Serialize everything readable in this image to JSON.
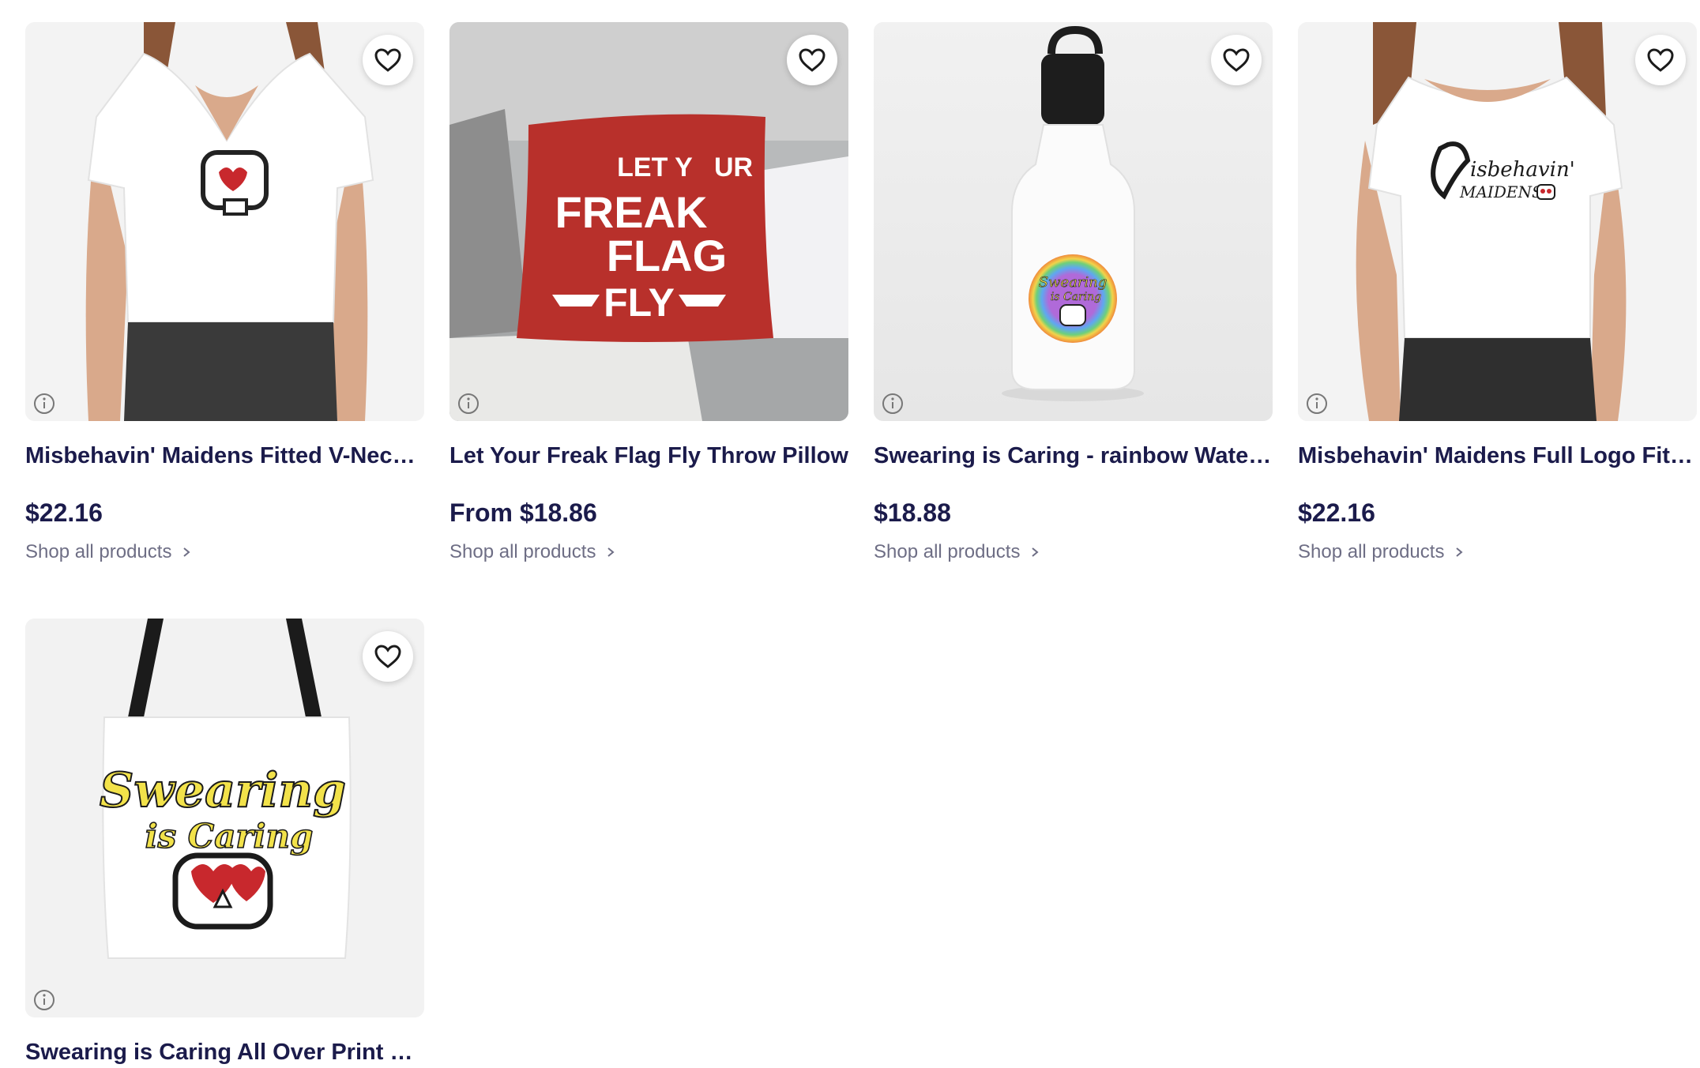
{
  "products": [
    {
      "title": "Misbehavin' Maidens Fitted V-Neck T-Shirt",
      "price": "$22.16",
      "shop_label": "Shop all products",
      "art_text": ""
    },
    {
      "title": "Let Your Freak Flag Fly Throw Pillow",
      "price": "From $18.86",
      "shop_label": "Shop all products",
      "art_lines": [
        "LET Y",
        "UR",
        "FREAK",
        "FLAG",
        "FLY"
      ]
    },
    {
      "title": "Swearing is Caring - rainbow Water Bottle",
      "price": "$18.88",
      "shop_label": "Shop all products",
      "art_lines": [
        "Swearing",
        "is Caring"
      ]
    },
    {
      "title": "Misbehavin' Maidens Full Logo Fitted Scoop T-Shirt",
      "price": "$22.16",
      "shop_label": "Shop all products",
      "art_lines": [
        "isbehavin'",
        "MAIDENS"
      ]
    },
    {
      "title": "Swearing is Caring All Over Print Tote Bag",
      "art_lines": [
        "Swearing",
        "is Caring"
      ]
    }
  ],
  "icons": {
    "favorite": "heart-outline-icon",
    "info": "info-circle-icon",
    "chevron": "chevron-right-icon"
  },
  "colors": {
    "title": "#1b1b4b",
    "muted": "#6e6e85",
    "heart_red": "#c8282d",
    "pillow_red": "#b8302b",
    "tote_yellow": "#f2e24a"
  }
}
